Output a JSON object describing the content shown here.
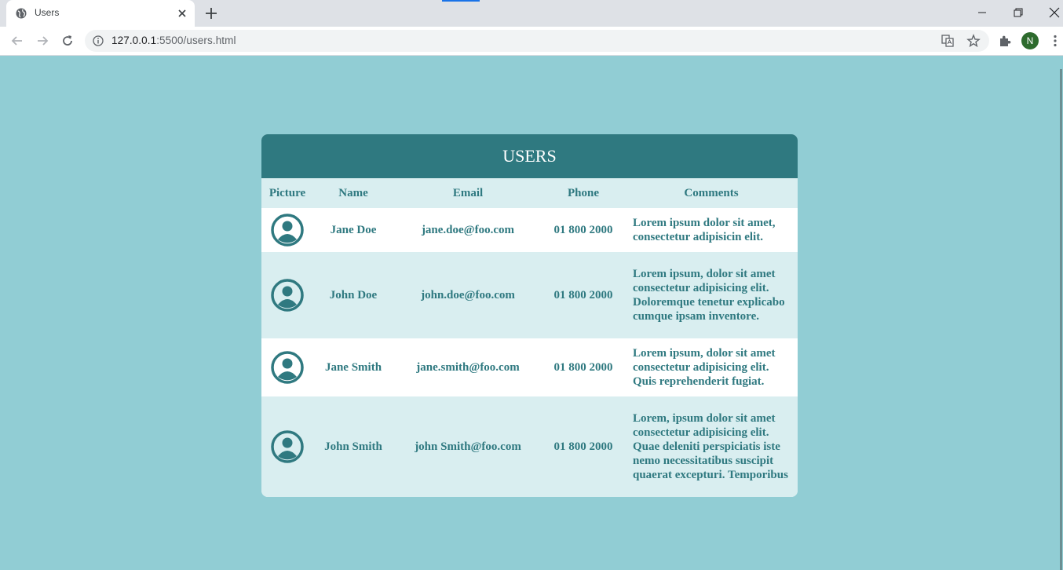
{
  "browser": {
    "tab_title": "Users",
    "url_host": "127.0.0.1",
    "url_rest": ":5500/users.html",
    "profile_initial": "N"
  },
  "page": {
    "title": "USERS",
    "columns": [
      "Picture",
      "Name",
      "Email",
      "Phone",
      "Comments"
    ],
    "rows": [
      {
        "name": "Jane Doe",
        "email": "jane.doe@foo.com",
        "phone": "01 800 2000",
        "comment": "Lorem ipsum dolor sit amet, consectetur adipisicin elit."
      },
      {
        "name": "John Doe",
        "email": "john.doe@foo.com",
        "phone": "01 800 2000",
        "comment": "Lorem ipsum, dolor sit amet consectetur adipisicing elit. Doloremque tenetur explicabo cumque ipsam inventore."
      },
      {
        "name": "Jane Smith",
        "email": "jane.smith@foo.com",
        "phone": "01 800 2000",
        "comment": "Lorem ipsum, dolor sit amet consectetur adipisicing elit. Quis reprehenderit fugiat."
      },
      {
        "name": "John Smith",
        "email": "john Smith@foo.com",
        "phone": "01 800 2000",
        "comment": "Lorem, ipsum dolor sit amet consectetur adipisicing elit. Quae deleniti perspiciatis iste nemo necessitatibus suscipit quaerat excepturi. Temporibus"
      }
    ]
  },
  "colors": {
    "background": "#91cdd4",
    "header": "#2f7980",
    "row_tint": "#d9eef0",
    "text": "#2f7980"
  }
}
